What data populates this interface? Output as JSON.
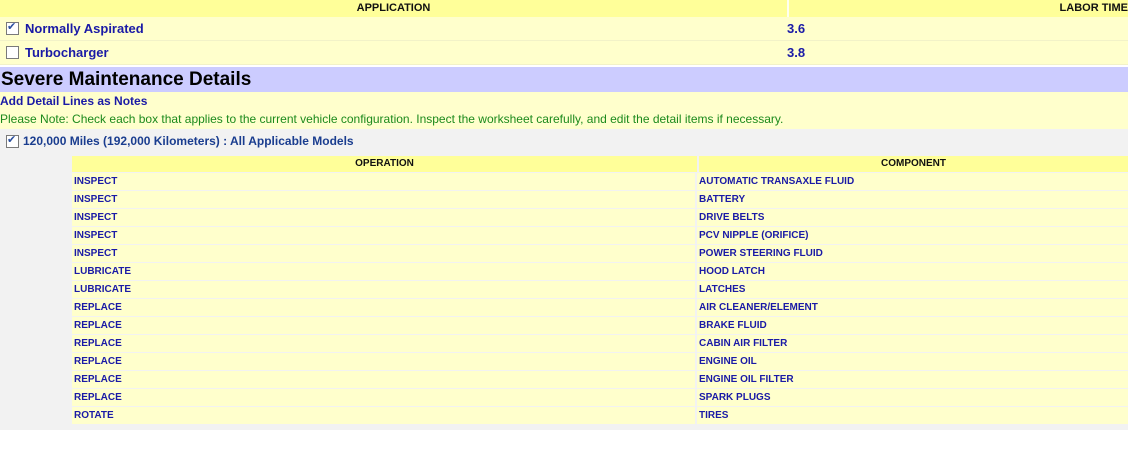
{
  "applications": {
    "header_application": "APPLICATION",
    "header_labor_time": "LABOR TIME",
    "rows": [
      {
        "name": "Normally Aspirated",
        "time": "3.6",
        "checked": true
      },
      {
        "name": "Turbocharger",
        "time": "3.8",
        "checked": false
      }
    ]
  },
  "severe": {
    "title": "Severe Maintenance Details",
    "add_notes_label": "Add Detail Lines as Notes",
    "please_note": "Please Note: Check each box that applies to the current vehicle configuration. Inspect the worksheet carefully, and edit the detail items if necessary.",
    "interval_label": "120,000 Miles (192,000 Kilometers) : All Applicable Models",
    "interval_checked": true,
    "header_operation": "OPERATION",
    "header_component": "COMPONENT",
    "rows": [
      {
        "operation": "INSPECT",
        "component": "AUTOMATIC TRANSAXLE FLUID"
      },
      {
        "operation": "INSPECT",
        "component": "BATTERY"
      },
      {
        "operation": "INSPECT",
        "component": "DRIVE BELTS"
      },
      {
        "operation": "INSPECT",
        "component": "PCV NIPPLE (ORIFICE)"
      },
      {
        "operation": "INSPECT",
        "component": "POWER STEERING FLUID"
      },
      {
        "operation": "LUBRICATE",
        "component": "HOOD LATCH"
      },
      {
        "operation": "LUBRICATE",
        "component": "LATCHES"
      },
      {
        "operation": "REPLACE",
        "component": "AIR CLEANER/ELEMENT"
      },
      {
        "operation": "REPLACE",
        "component": "BRAKE FLUID"
      },
      {
        "operation": "REPLACE",
        "component": "CABIN AIR FILTER"
      },
      {
        "operation": "REPLACE",
        "component": "ENGINE OIL"
      },
      {
        "operation": "REPLACE",
        "component": "ENGINE OIL FILTER"
      },
      {
        "operation": "REPLACE",
        "component": "SPARK PLUGS"
      },
      {
        "operation": "ROTATE",
        "component": "TIRES"
      }
    ]
  },
  "colors": {
    "header_yellow": "#ffff99",
    "row_yellow": "#ffffcc",
    "section_lavender": "#ccccff",
    "link_blue": "#1a1aa6",
    "note_green": "#1c8a1c"
  },
  "icons": {
    "checkbox": "checkbox-icon"
  }
}
